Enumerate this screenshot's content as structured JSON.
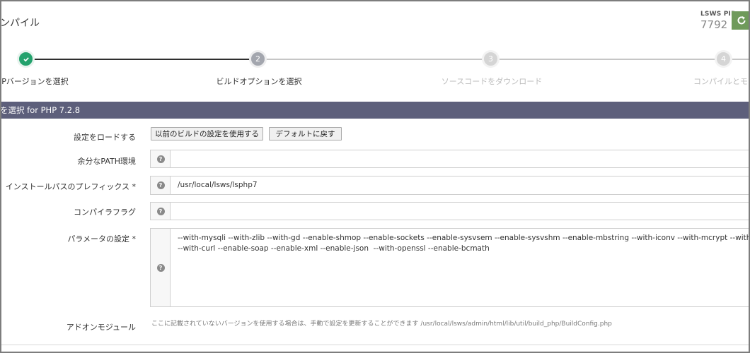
{
  "header": {
    "page_title": "コンパイル",
    "pid_label": "LSWS PID",
    "pid_value": "7792"
  },
  "steps": [
    {
      "number": "✓",
      "label": "PHPバージョンを選択",
      "state": "done"
    },
    {
      "number": "2",
      "label": "ビルドオプションを選択",
      "state": "active"
    },
    {
      "number": "3",
      "label": "ソースコードをダウンロード",
      "state": "pending"
    },
    {
      "number": "4",
      "label": "コンパイルとモニ",
      "state": "pending"
    }
  ],
  "section": {
    "title": "を選択 for PHP 7.2.8"
  },
  "form": {
    "load_settings_label": "設定をロードする",
    "use_previous_button": "以前のビルドの設定を使用する",
    "reset_default_button": "デフォルトに戻す",
    "extra_path_label": "余分なPATH環境",
    "extra_path_value": "",
    "install_prefix_label": "インストールパスのプレフィックス *",
    "install_prefix_value": "/usr/local/lsws/lsphp7",
    "compiler_flags_label": "コンパイラフラグ",
    "compiler_flags_value": "",
    "params_label": "パラメータの設定 *",
    "params_value": "--with-mysqli --with-zlib --with-gd --enable-shmop --enable-sockets --enable-sysvsem --enable-sysvshm --enable-mbstring --with-iconv --with-mcrypt --with-pdo-mysql --enable-ftp\n--with-curl --enable-soap --enable-xml --enable-json  --with-openssl --enable-bcmath",
    "addon_label": "アドオンモジュール",
    "addon_note": "ここに記載されていないバージョンを使用する場合は、手動で設定を更新することができます /usr/local/lsws/admin/html/lib/util/build_php/BuildConfig.php"
  },
  "icons": {
    "help": "question-circle-icon",
    "check": "check-icon",
    "restart": "refresh-icon"
  },
  "colors": {
    "section_bar": "#5d5f7b",
    "step_done": "#23a26d",
    "step_active": "#a3a6ae",
    "step_pending": "#d5d5d5",
    "restart_button": "#6f9a5b"
  }
}
